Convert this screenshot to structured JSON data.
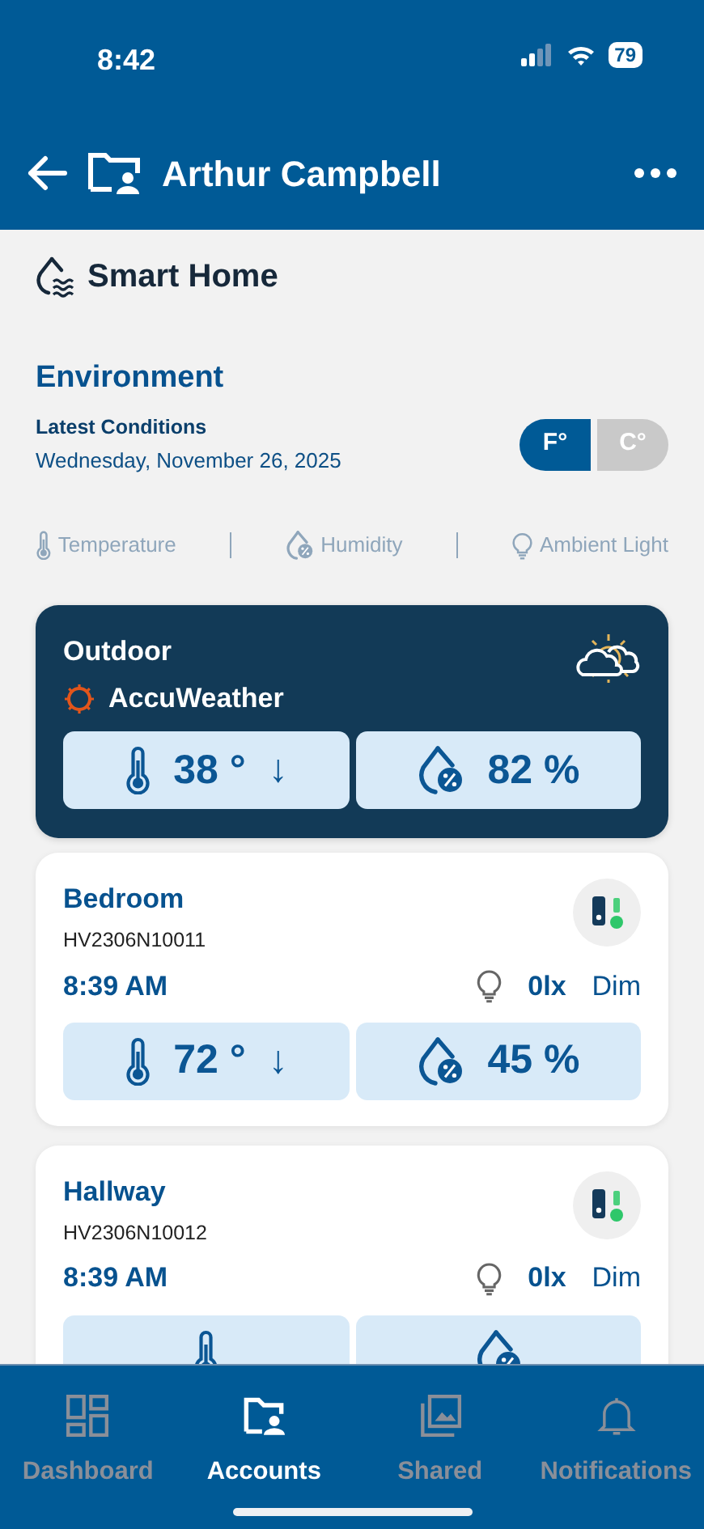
{
  "status_bar": {
    "time": "8:42",
    "battery": "79"
  },
  "header": {
    "title": "Arthur Campbell"
  },
  "section": {
    "title": "Smart Home"
  },
  "environment": {
    "title": "Environment",
    "subtitle": "Latest Conditions",
    "date": "Wednesday, November 26, 2025",
    "units": [
      {
        "label": "F°",
        "selected": true
      },
      {
        "label": "C°",
        "selected": false
      }
    ],
    "legend": [
      {
        "kind": "temperature",
        "label": "Temperature"
      },
      {
        "kind": "humidity",
        "label": "Humidity"
      },
      {
        "kind": "light",
        "label": "Ambient Light"
      }
    ]
  },
  "cards": [
    {
      "kind": "outdoor",
      "title": "Outdoor",
      "source": "AccuWeather",
      "temperature": "38 °",
      "trend": "↓",
      "humidity": "82 %"
    },
    {
      "kind": "sensor",
      "title": "Bedroom",
      "serial": "HV2306N10011",
      "time": "8:39 AM",
      "lux": "0lx",
      "light": "Dim",
      "online": true,
      "temperature": "72 °",
      "trend": "↓",
      "humidity": "45 %"
    },
    {
      "kind": "sensor",
      "title": "Hallway",
      "serial": "HV2306N10012",
      "time": "8:39 AM",
      "lux": "0lx",
      "light": "Dim",
      "online": true
    }
  ],
  "tabs": [
    {
      "kind": "dashboard",
      "label": "Dashboard",
      "selected": false
    },
    {
      "kind": "accounts",
      "label": "Accounts",
      "selected": true
    },
    {
      "kind": "shared",
      "label": "Shared",
      "selected": false
    },
    {
      "kind": "notifications",
      "label": "Notifications",
      "selected": false
    }
  ]
}
